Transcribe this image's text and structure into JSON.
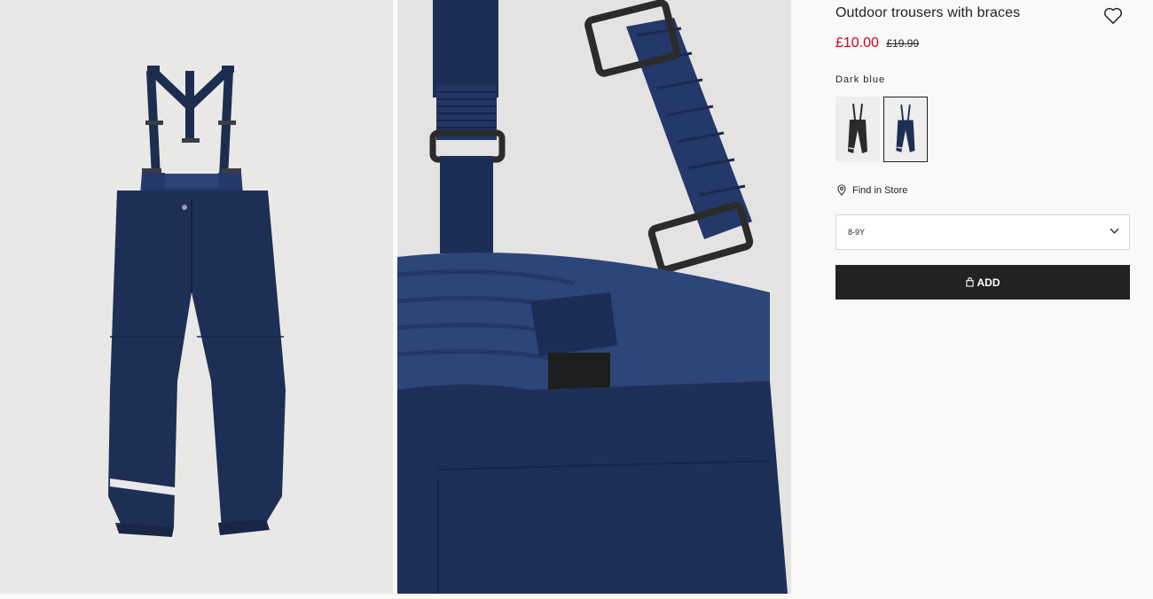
{
  "product": {
    "title": "Outdoor trousers with braces",
    "price_now": "£10.00",
    "price_was": "£19.99"
  },
  "color": {
    "selected_label": "Dark blue",
    "swatches": [
      {
        "name": "black",
        "color": "#2a2b2d",
        "selected": false
      },
      {
        "name": "dark-blue",
        "color": "#1e2f55",
        "selected": true
      }
    ]
  },
  "store": {
    "label": "Find in Store"
  },
  "size": {
    "selected": "8-9Y"
  },
  "cart": {
    "add_label": "ADD"
  },
  "icons": {
    "favorite": "heart-icon",
    "location": "location-pin-icon",
    "dropdown": "chevron-down-icon",
    "bag": "shopping-bag-icon"
  },
  "colors": {
    "accent_price": "#d6001c",
    "button_bg": "#222222",
    "garment": "#1e2f55"
  }
}
